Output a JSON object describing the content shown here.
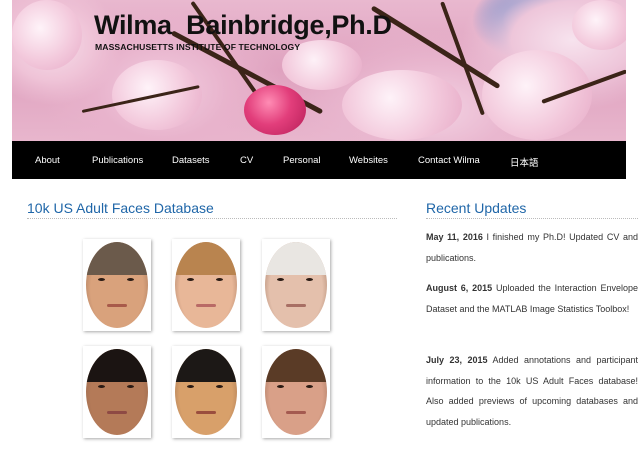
{
  "header": {
    "title": "Wilma  Bainbridge,Ph.D",
    "subtitle": "MASSACHUSETTS INSTITUTE OF TECHNOLOGY"
  },
  "nav": {
    "items": [
      {
        "label": "About"
      },
      {
        "label": "Publications"
      },
      {
        "label": "Datasets"
      },
      {
        "label": "CV"
      },
      {
        "label": "Personal"
      },
      {
        "label": "Websites"
      },
      {
        "label": "Contact Wilma"
      },
      {
        "label": "日本語"
      }
    ]
  },
  "main": {
    "title": "10k US Adult Faces Database",
    "faces": [
      {
        "skin": "#d9a27c",
        "hair": "#6b5a4b",
        "mouth": "#a85a4a"
      },
      {
        "skin": "#e8b798",
        "hair": "#b9844f",
        "mouth": "#b96a66"
      },
      {
        "skin": "#e4c0ac",
        "hair": "#e9e6e2",
        "mouth": "#a86f64"
      },
      {
        "skin": "#b47a58",
        "hair": "#1b1412",
        "mouth": "#8e4a44"
      },
      {
        "skin": "#d8a06a",
        "hair": "#1c1816",
        "mouth": "#9a4e3e"
      },
      {
        "skin": "#d9a088",
        "hair": "#5a3b26",
        "mouth": "#a45a50"
      }
    ]
  },
  "sidebar": {
    "title": "Recent Updates",
    "updates": [
      {
        "date": "May 11, 2016",
        "text": " I finished my Ph.D! Updated CV and publications."
      },
      {
        "date": "August 6, 2015",
        "text": " Uploaded the Interaction Envelope Dataset and the MATLAB Image Statistics Toolbox!"
      },
      {
        "date": "July 23, 2015",
        "text": " Added annotations and participant information to the 10k US Adult Faces database! Also added previews of upcoming databases and updated publications."
      }
    ]
  }
}
